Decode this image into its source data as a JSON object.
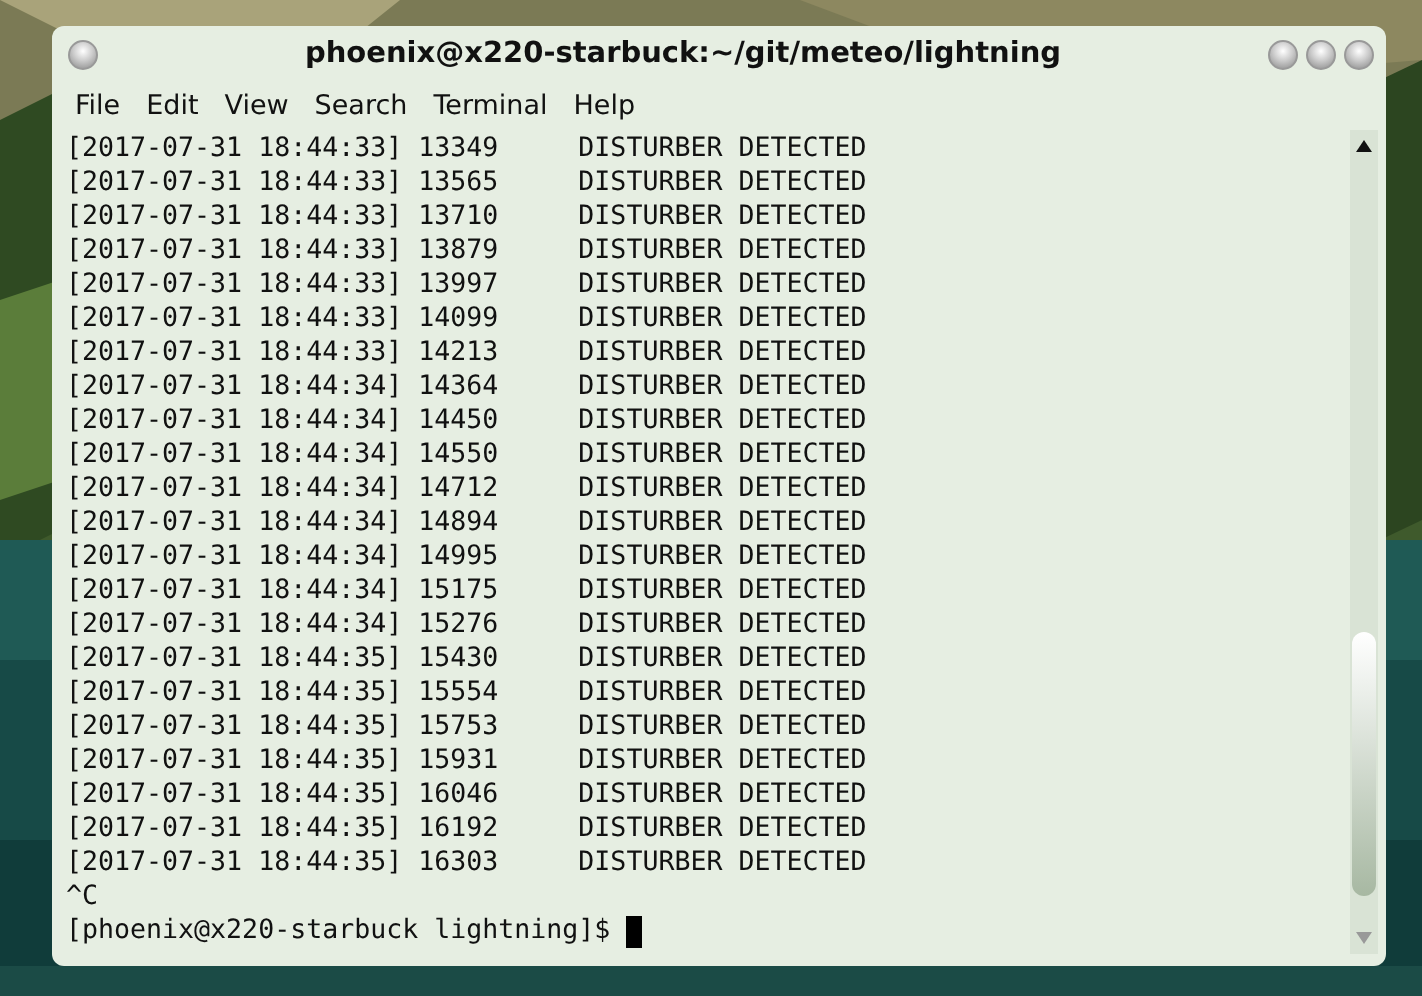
{
  "window": {
    "title": "phoenix@x220-starbuck:~/git/meteo/lightning"
  },
  "menu": [
    "File",
    "Edit",
    "View",
    "Search",
    "Terminal",
    "Help"
  ],
  "terminal": {
    "lines": [
      "[2017-07-31 18:44:33] 13349     DISTURBER DETECTED",
      "[2017-07-31 18:44:33] 13565     DISTURBER DETECTED",
      "[2017-07-31 18:44:33] 13710     DISTURBER DETECTED",
      "[2017-07-31 18:44:33] 13879     DISTURBER DETECTED",
      "[2017-07-31 18:44:33] 13997     DISTURBER DETECTED",
      "[2017-07-31 18:44:33] 14099     DISTURBER DETECTED",
      "[2017-07-31 18:44:33] 14213     DISTURBER DETECTED",
      "[2017-07-31 18:44:34] 14364     DISTURBER DETECTED",
      "[2017-07-31 18:44:34] 14450     DISTURBER DETECTED",
      "[2017-07-31 18:44:34] 14550     DISTURBER DETECTED",
      "[2017-07-31 18:44:34] 14712     DISTURBER DETECTED",
      "[2017-07-31 18:44:34] 14894     DISTURBER DETECTED",
      "[2017-07-31 18:44:34] 14995     DISTURBER DETECTED",
      "[2017-07-31 18:44:34] 15175     DISTURBER DETECTED",
      "[2017-07-31 18:44:34] 15276     DISTURBER DETECTED",
      "[2017-07-31 18:44:35] 15430     DISTURBER DETECTED",
      "[2017-07-31 18:44:35] 15554     DISTURBER DETECTED",
      "[2017-07-31 18:44:35] 15753     DISTURBER DETECTED",
      "[2017-07-31 18:44:35] 15931     DISTURBER DETECTED",
      "[2017-07-31 18:44:35] 16046     DISTURBER DETECTED",
      "[2017-07-31 18:44:35] 16192     DISTURBER DETECTED",
      "[2017-07-31 18:44:35] 16303     DISTURBER DETECTED",
      "^C"
    ],
    "prompt": "[phoenix@x220-starbuck lightning]$ "
  }
}
